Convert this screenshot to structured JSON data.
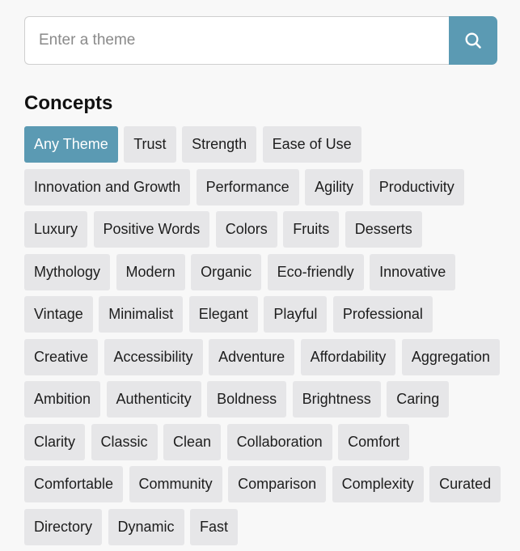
{
  "search": {
    "placeholder": "Enter a theme",
    "button_icon": "search-icon"
  },
  "concepts": {
    "heading": "Concepts",
    "active_color": "#5b9ab3",
    "tags": [
      {
        "label": "Any Theme",
        "active": true
      },
      {
        "label": "Trust"
      },
      {
        "label": "Strength"
      },
      {
        "label": "Ease of Use"
      },
      {
        "label": "Innovation and Growth"
      },
      {
        "label": "Performance"
      },
      {
        "label": "Agility"
      },
      {
        "label": "Productivity"
      },
      {
        "label": "Luxury"
      },
      {
        "label": "Positive Words"
      },
      {
        "label": "Colors"
      },
      {
        "label": "Fruits"
      },
      {
        "label": "Desserts"
      },
      {
        "label": "Mythology"
      },
      {
        "label": "Modern"
      },
      {
        "label": "Organic"
      },
      {
        "label": "Eco-friendly"
      },
      {
        "label": "Innovative"
      },
      {
        "label": "Vintage"
      },
      {
        "label": "Minimalist"
      },
      {
        "label": "Elegant"
      },
      {
        "label": "Playful"
      },
      {
        "label": "Professional"
      },
      {
        "label": "Creative"
      },
      {
        "label": "Accessibility"
      },
      {
        "label": "Adventure"
      },
      {
        "label": "Affordability"
      },
      {
        "label": "Aggregation"
      },
      {
        "label": "Ambition"
      },
      {
        "label": "Authenticity"
      },
      {
        "label": "Boldness"
      },
      {
        "label": "Brightness"
      },
      {
        "label": "Caring"
      },
      {
        "label": "Clarity"
      },
      {
        "label": "Classic"
      },
      {
        "label": "Clean"
      },
      {
        "label": "Collaboration"
      },
      {
        "label": "Comfort"
      },
      {
        "label": "Comfortable"
      },
      {
        "label": "Community"
      },
      {
        "label": "Comparison"
      },
      {
        "label": "Complexity"
      },
      {
        "label": "Curated"
      },
      {
        "label": "Directory"
      },
      {
        "label": "Dynamic"
      },
      {
        "label": "Fast"
      }
    ]
  }
}
